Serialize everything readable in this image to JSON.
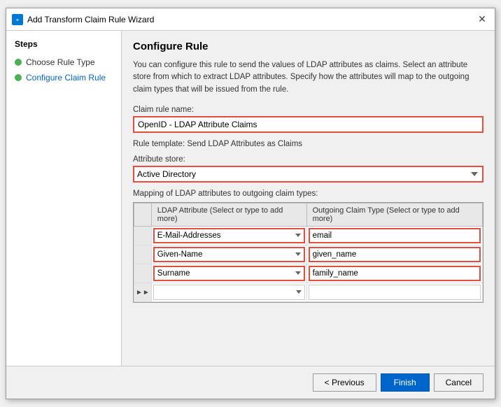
{
  "dialog": {
    "title": "Add Transform Claim Rule Wizard",
    "close_label": "✕"
  },
  "sidebar": {
    "title": "Steps",
    "items": [
      {
        "id": "choose-type",
        "label": "Choose Rule Type",
        "state": "completed"
      },
      {
        "id": "configure",
        "label": "Configure Claim Rule",
        "state": "active"
      }
    ]
  },
  "main": {
    "page_title": "Configure Rule",
    "description": "You can configure this rule to send the values of LDAP attributes as claims. Select an attribute store from which to extract LDAP attributes. Specify how the attributes will map to the outgoing claim types that will be issued from the rule.",
    "claim_rule_name_label": "Claim rule name:",
    "claim_rule_name_value": "OpenID - LDAP Attribute Claims",
    "rule_template_text": "Rule template: Send LDAP Attributes as Claims",
    "attribute_store_label": "Attribute store:",
    "attribute_store_value": "Active Directory",
    "mapping_label": "Mapping of LDAP attributes to outgoing claim types:",
    "table": {
      "col1_header": "LDAP Attribute (Select or type to add more)",
      "col2_header": "Outgoing Claim Type (Select or type to add more)",
      "rows": [
        {
          "ldap": "E-Mail-Addresses",
          "claim": "email"
        },
        {
          "ldap": "Given-Name",
          "claim": "given_name"
        },
        {
          "ldap": "Surname",
          "claim": "family_name"
        }
      ]
    }
  },
  "buttons": {
    "previous": "< Previous",
    "finish": "Finish",
    "cancel": "Cancel"
  }
}
